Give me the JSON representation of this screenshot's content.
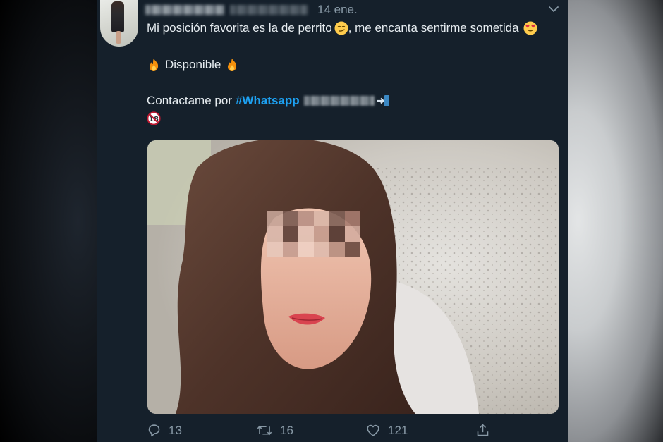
{
  "tweet": {
    "date": "14 ene.",
    "text": {
      "line1_a": "Mi posición favorita es la de perrito",
      "line1_b": ", me encanta sentirme sometida",
      "line2": "Disponible",
      "line3_prefix": "Contactame por",
      "hashtag": "#Whatsapp"
    },
    "icons": {
      "caret": "chevron-down-icon",
      "smirk": "smirk-emoji",
      "heart_eyes": "heart-eyes-emoji",
      "fire": "fire-emoji",
      "arrow": "arrow-right-emoji",
      "under18": "no-under-18-emoji"
    },
    "actions": {
      "reply_count": "13",
      "retweet_count": "16",
      "like_count": "121"
    }
  },
  "colors": {
    "background": "#15202b",
    "text": "#e6ecf0",
    "secondary": "#8899a6",
    "link": "#1da1f2"
  }
}
